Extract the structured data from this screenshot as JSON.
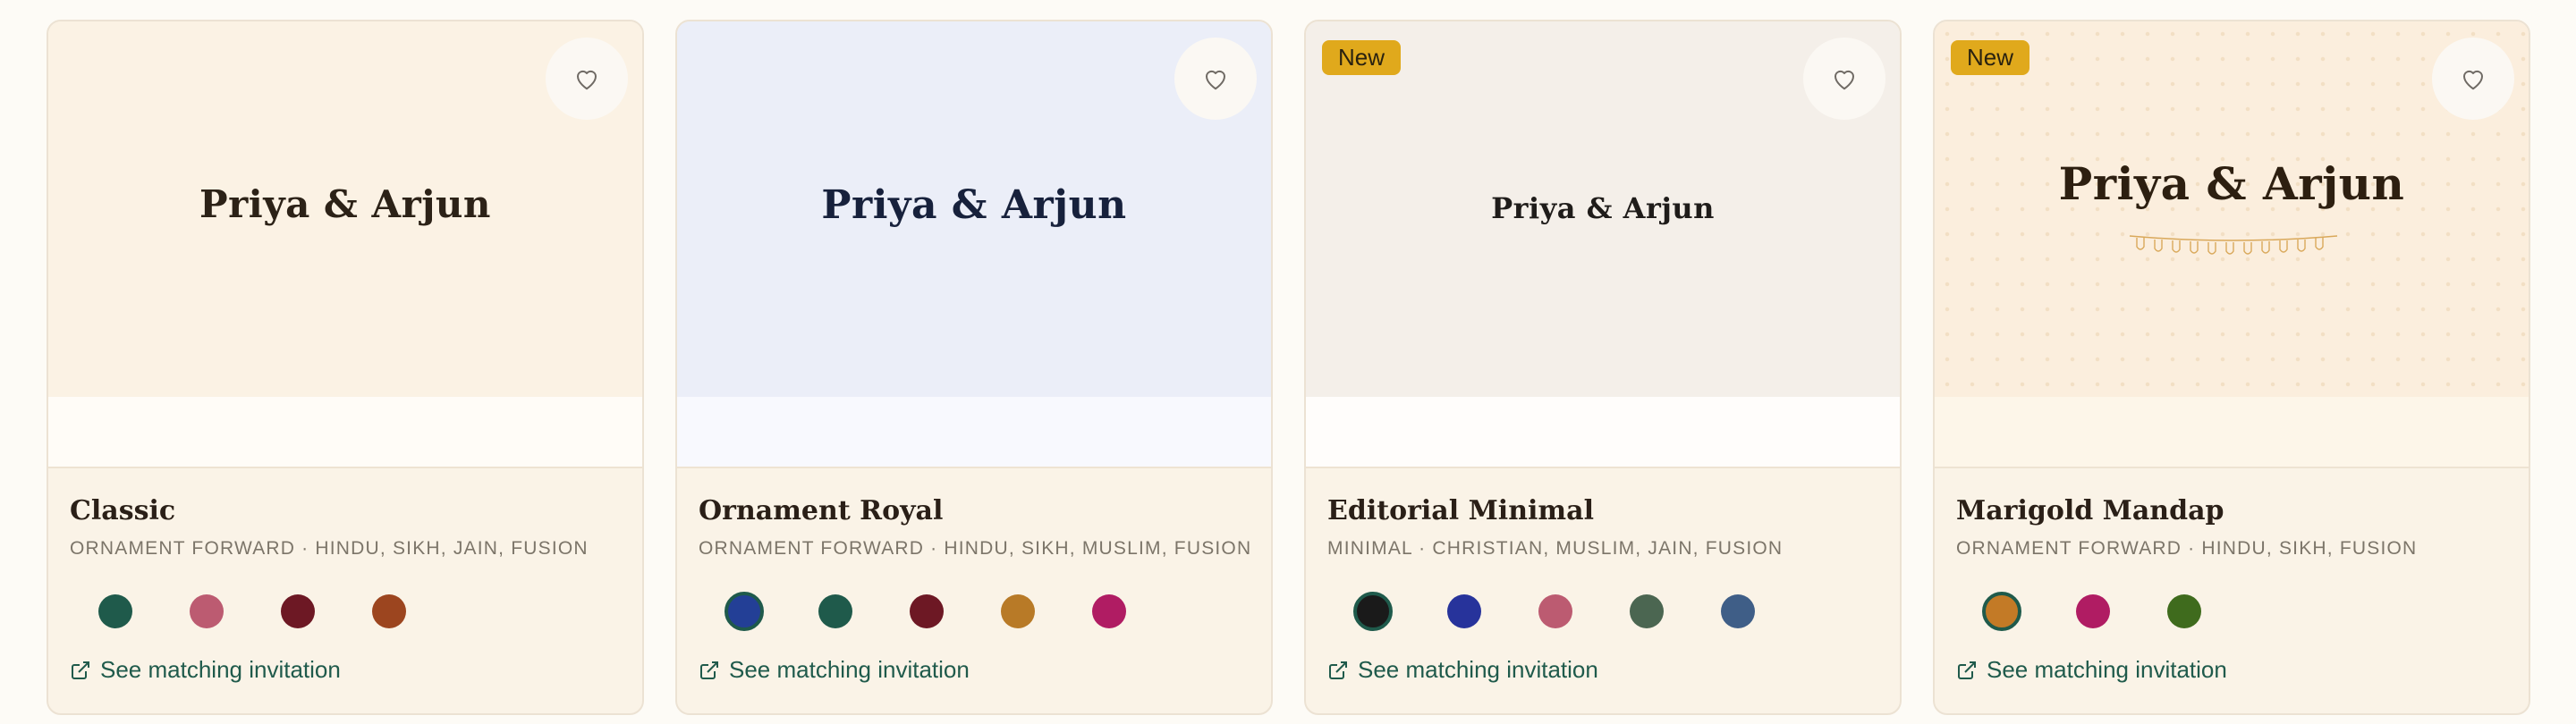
{
  "cards": [
    {
      "badge": "",
      "preview_names": "Priya & Arjun",
      "hero_bg": "#fbf2e4",
      "strip_bg": "#fffcf7",
      "names_color": "#2c2217",
      "title": "Classic",
      "subtitle": "ORNAMENT FORWARD · HINDU, SIKH, JAIN, FUSION",
      "swatches": [
        "#1f5a4b",
        "#bc5b71",
        "#6d1824",
        "#9c451f"
      ],
      "link_label": "See matching invitation"
    },
    {
      "badge": "",
      "preview_names": "Priya & Arjun",
      "hero_bg": "#ebeef8",
      "strip_bg": "#f8f9fe",
      "names_color": "#17213c",
      "title": "Ornament Royal",
      "subtitle": "ORNAMENT FORWARD · HINDU, SIKH, MUSLIM, FUSION",
      "swatches": [
        "#233f96",
        "#1f5a4b",
        "#6d1824",
        "#b87a27",
        "#b01c63"
      ],
      "link_label": "See matching invitation"
    },
    {
      "badge": "New",
      "preview_names": "Priya & Arjun",
      "hero_bg": "#f4efe9",
      "strip_bg": "#fffdfb",
      "names_color": "#1f1c1a",
      "title": "Editorial Minimal",
      "subtitle": "MINIMAL · CHRISTIAN, MUSLIM, JAIN, FUSION",
      "swatches": [
        "#1a1a1a",
        "#27339b",
        "#bc5b71",
        "#4b6651",
        "#3f5e87"
      ],
      "link_label": "See matching invitation"
    },
    {
      "badge": "New",
      "preview_names": "Priya & Arjun",
      "hero_bg": "#fbeedd",
      "strip_bg": "#fdf6e9",
      "names_color": "#2d1f10",
      "title": "Marigold Mandap",
      "subtitle": "ORNAMENT FORWARD · HINDU, SIKH, FUSION",
      "swatches": [
        "#c37a26",
        "#b01c63",
        "#3f6b1d"
      ],
      "link_label": "See matching invitation"
    }
  ]
}
